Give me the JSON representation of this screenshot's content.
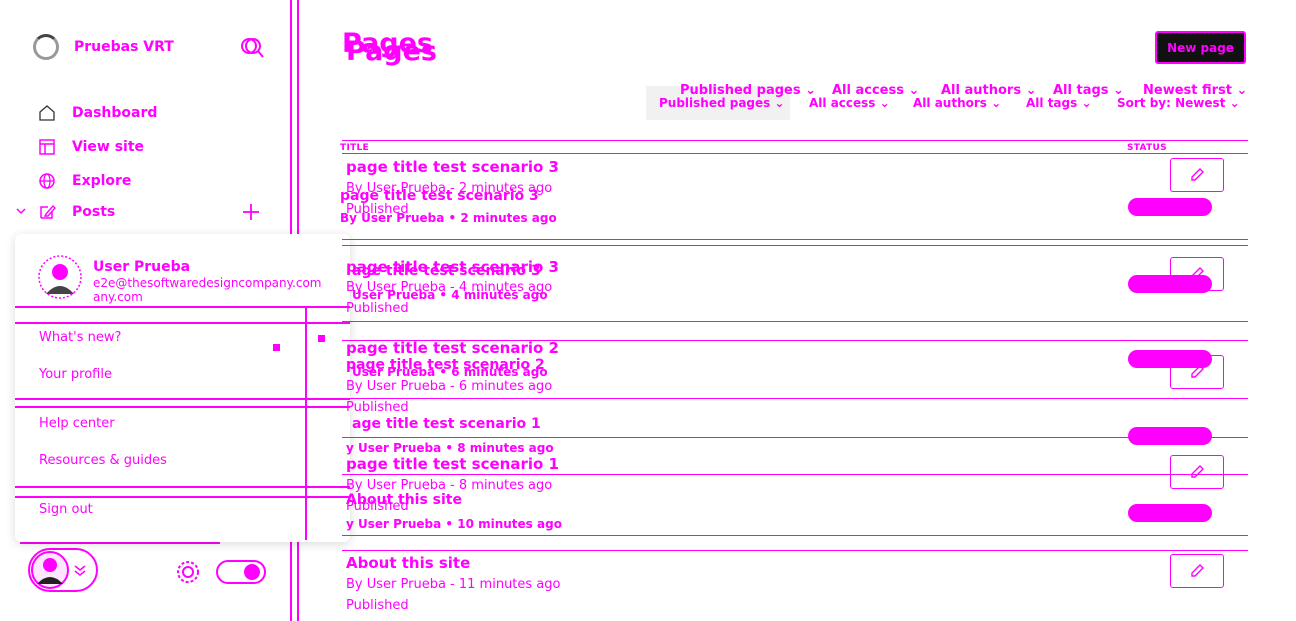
{
  "brand": {
    "name": "Pruebas VRT"
  },
  "nav": {
    "dashboard": "Dashboard",
    "view_site": "View site",
    "explore": "Explore",
    "posts": "Posts"
  },
  "user_menu": {
    "name": "User Prueba",
    "email_line1": "e2e@thesoftwaredesigncompany.com",
    "email_line2": "any.com",
    "whats_new": "What's new?",
    "your_profile": "Your profile",
    "help_center": "Help center",
    "resources": "Resources & guides",
    "sign_out": "Sign out"
  },
  "page": {
    "title": "Pages",
    "new_button": "New page"
  },
  "filters_top": {
    "type": "Published pages",
    "access": "All access",
    "authors": "All authors",
    "tags": "All tags",
    "order": "Newest first"
  },
  "filters_bottom": {
    "type": "Published pages",
    "access": "All access",
    "authors": "All authors",
    "tags": "All tags",
    "order": "Sort by: Newest"
  },
  "table": {
    "col_title": "TITLE",
    "col_status": "STATUS"
  },
  "rows_a": [
    {
      "title": "page title test scenario 3",
      "meta": "By User Prueba - 2 minutes ago",
      "status": "Published"
    },
    {
      "title": "page title test scenario 3",
      "meta": "By User Prueba - 4 minutes ago",
      "status": "Published"
    },
    {
      "title": "page title test scenario 2",
      "meta": "By User Prueba - 6 minutes ago",
      "status": "Published"
    },
    {
      "title": "page title test scenario 1",
      "meta": "By User Prueba - 8 minutes ago",
      "status": "Published"
    },
    {
      "title": "About this site",
      "meta": "By User Prueba - 11 minutes ago",
      "status": "Published"
    }
  ],
  "rows_b": [
    {
      "title": "page title test scenario 3",
      "meta": "By User Prueba • 2 minutes ago"
    },
    {
      "title": "age title test scenario 3",
      "meta": "User Prueba • 4 minutes ago"
    },
    {
      "title": "page title test scenario 2",
      "meta": "User Prueba • 6 minutes ago"
    },
    {
      "title": "age title test scenario 1",
      "meta": "y User Prueba • 8 minutes ago"
    },
    {
      "title": "About this site",
      "meta": "y User Prueba • 10 minutes ago"
    }
  ],
  "colors": {
    "accent": "#ff00ff",
    "dark": "#111111"
  }
}
